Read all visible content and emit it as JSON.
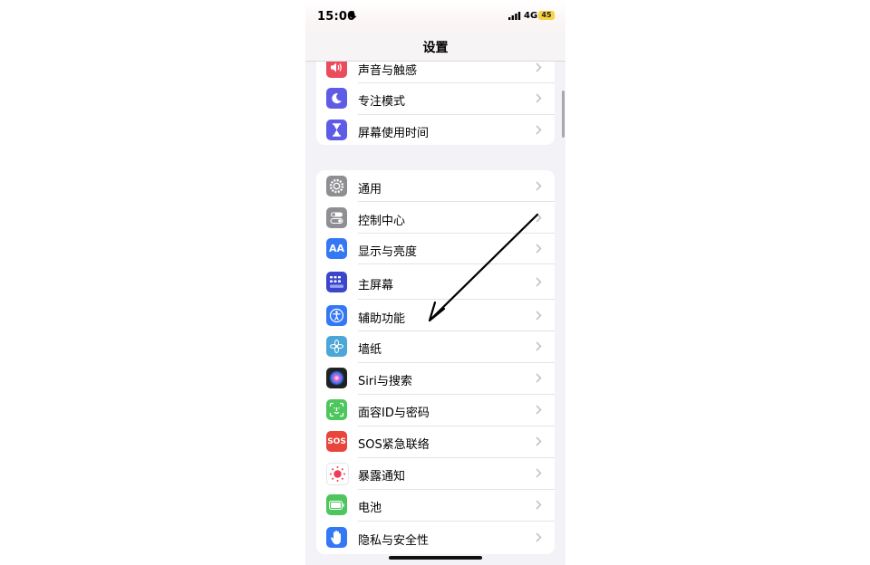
{
  "status_bar": {
    "time": "15:00",
    "network": "4G",
    "battery": "45"
  },
  "nav": {
    "title": "设置"
  },
  "group1": [
    {
      "label": "声音与触感",
      "icon": "speaker-icon",
      "color": "#eb4b5b"
    },
    {
      "label": "专注模式",
      "icon": "moon-icon",
      "color": "#5e5ce6"
    },
    {
      "label": "屏幕使用时间",
      "icon": "hourglass-icon",
      "color": "#5e5ce6"
    }
  ],
  "group2": [
    {
      "label": "通用",
      "icon": "gear-icon",
      "color": "#8e8e93"
    },
    {
      "label": "控制中心",
      "icon": "toggles-icon",
      "color": "#8e8e93"
    },
    {
      "label": "显示与亮度",
      "icon": "text-size-icon",
      "color": "#3478f6"
    },
    {
      "label": "主屏幕",
      "icon": "home-grid-icon",
      "color": "#3b47c8"
    },
    {
      "label": "辅助功能",
      "icon": "accessibility-icon",
      "color": "#3478f6"
    },
    {
      "label": "墙纸",
      "icon": "flower-icon",
      "color": "#4ba7d8"
    },
    {
      "label": "Siri与搜索",
      "icon": "siri-icon",
      "color": "#222222"
    },
    {
      "label": "面容ID与密码",
      "icon": "face-id-icon",
      "color": "#4cc65d"
    },
    {
      "label": "SOS紧急联络",
      "icon": "sos-icon",
      "color": "#e8453c",
      "icon_text": "SOS"
    },
    {
      "label": "暴露通知",
      "icon": "exposure-icon",
      "color": "#ffffff"
    },
    {
      "label": "电池",
      "icon": "battery-icon",
      "color": "#4cc65d"
    },
    {
      "label": "隐私与安全性",
      "icon": "hand-icon",
      "color": "#3478f6"
    }
  ]
}
